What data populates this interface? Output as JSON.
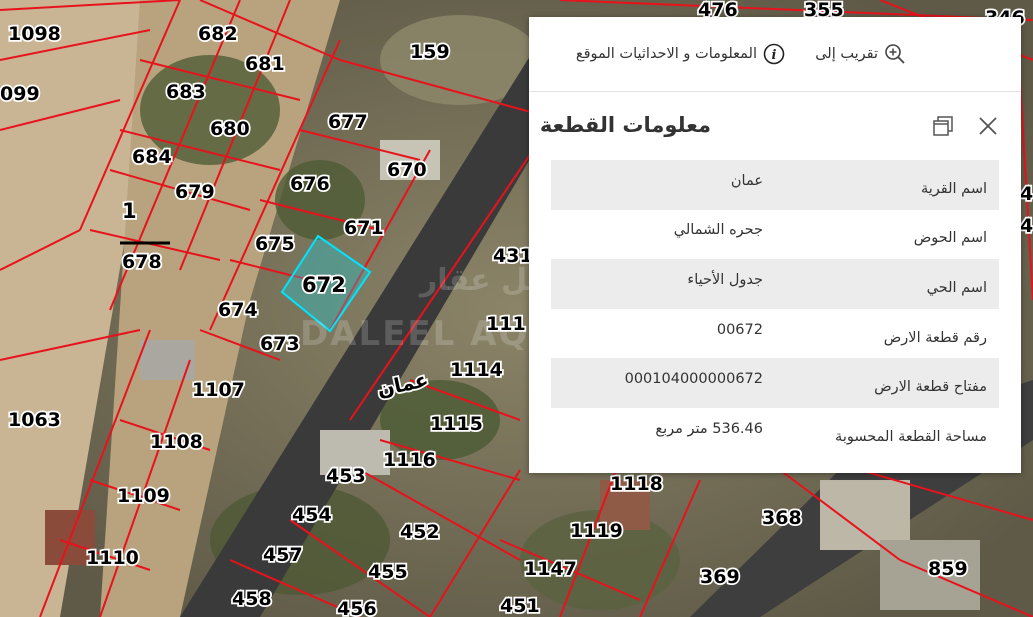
{
  "map": {
    "plots": [
      "1098",
      "682",
      "681",
      "476",
      "355",
      "346",
      "099",
      "683",
      "159",
      "680",
      "677",
      "684",
      "679",
      "676",
      "670",
      "1",
      "678",
      "675",
      "671",
      "672",
      "431",
      "674",
      "673",
      "111",
      "1107",
      "1114",
      "1063",
      "1115",
      "1108",
      "453",
      "1116",
      "1109",
      "454",
      "452",
      "1118",
      "1119",
      "368",
      "1110",
      "457",
      "455",
      "1147",
      "369",
      "859",
      "458",
      "456",
      "451",
      "4",
      "4"
    ],
    "area_label": "عمان",
    "watermark": "DALEEL AQAR",
    "watermark_ar": "دليل عقار"
  },
  "panel": {
    "zoom_label": "تقريب إلى",
    "location_info_label": "المعلومات و الاحداثيات الموقع",
    "title": "معلومات القطعة",
    "rows": [
      {
        "key": "اسم القرية",
        "value": "عمان"
      },
      {
        "key": "اسم الحوض",
        "value": "جحره الشمالي"
      },
      {
        "key": "اسم الحي",
        "value": "جدول الأحياء"
      },
      {
        "key": "رقم قطعة الارض",
        "value": "00672"
      },
      {
        "key": "مفتاح قطعة الارض",
        "value": "000104000000672"
      },
      {
        "key": "مساحة القطعة المحسوبة",
        "value": "536.46 متر مربع"
      }
    ]
  },
  "colors": {
    "parcel_line": "#e8121c",
    "selected_parcel": "#00e5ff",
    "panel_row_alt": "#ececec"
  }
}
